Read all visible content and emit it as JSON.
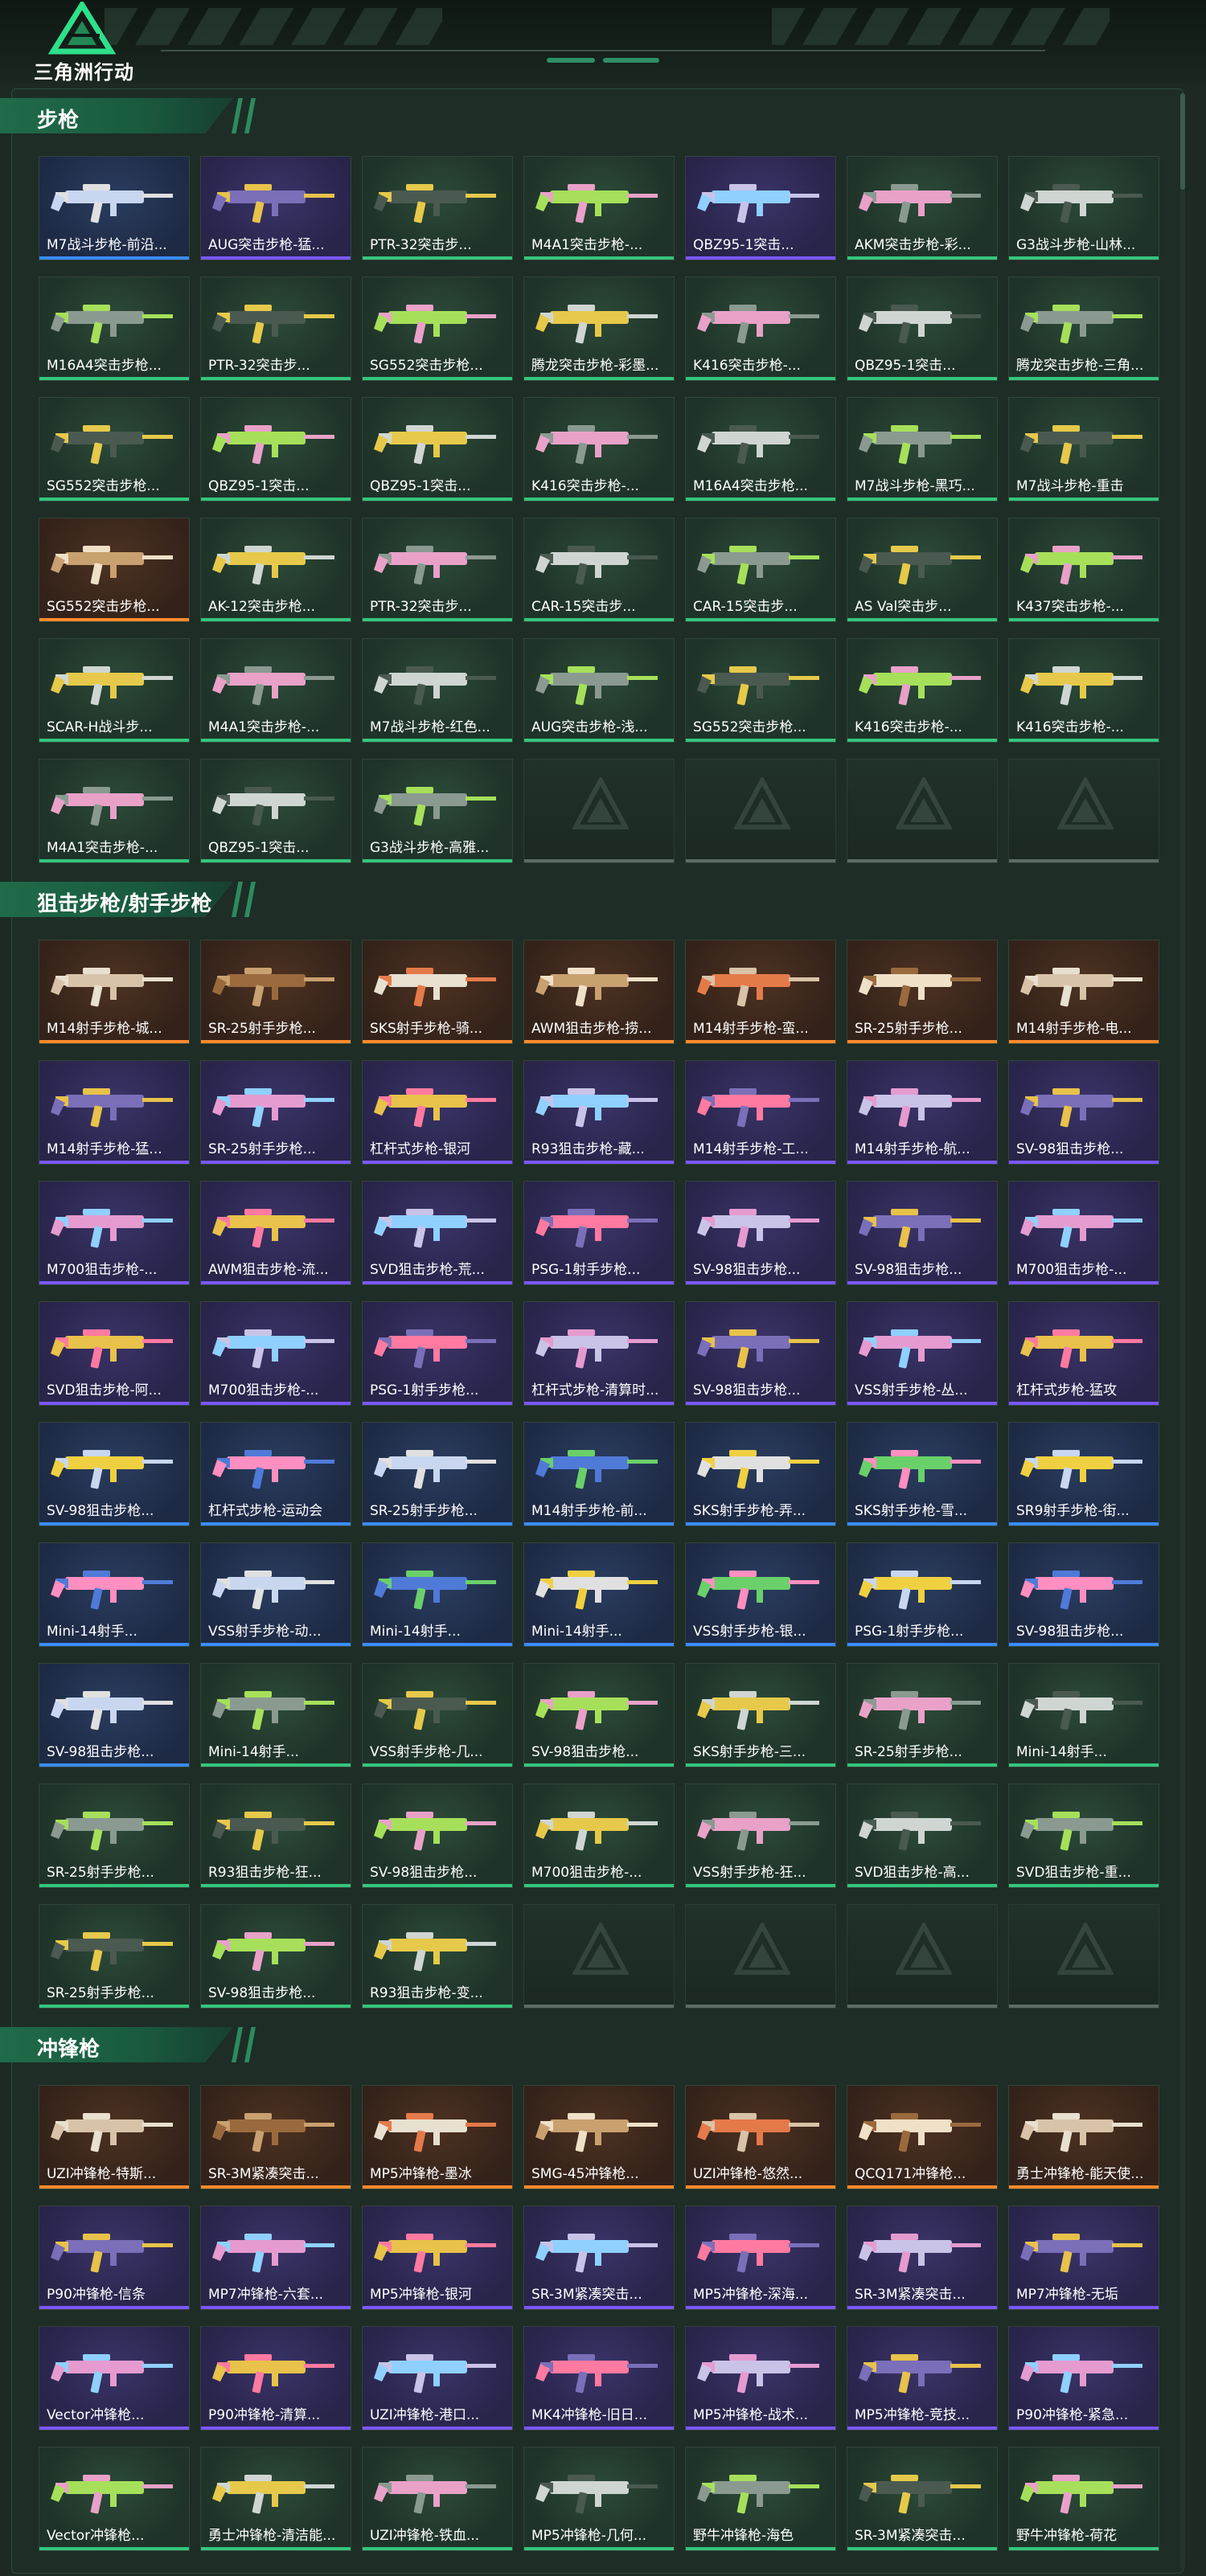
{
  "app": {
    "logo_text": "三角洲行动"
  },
  "colors": {
    "green": "#34c57d",
    "purple": "#7b57ff",
    "orange": "#ff8a2a",
    "blue": "#3a8cff"
  },
  "sections": [
    {
      "title": "步枪",
      "items": [
        {
          "name": "M7战斗步枪-前沿...",
          "rarity": "blue"
        },
        {
          "name": "AUG突击步枪-猛...",
          "rarity": "purple"
        },
        {
          "name": "PTR-32突击步...",
          "rarity": "green"
        },
        {
          "name": "M4A1突击步枪-...",
          "rarity": "green"
        },
        {
          "name": "QBZ95-1突击...",
          "rarity": "purple"
        },
        {
          "name": "AKM突击步枪-彩...",
          "rarity": "green"
        },
        {
          "name": "G3战斗步枪-山林...",
          "rarity": "green"
        },
        {
          "name": "M16A4突击步枪...",
          "rarity": "green"
        },
        {
          "name": "PTR-32突击步...",
          "rarity": "green"
        },
        {
          "name": "SG552突击步枪...",
          "rarity": "green"
        },
        {
          "name": "腾龙突击步枪-彩墨...",
          "rarity": "green"
        },
        {
          "name": "K416突击步枪-...",
          "rarity": "green"
        },
        {
          "name": "QBZ95-1突击...",
          "rarity": "green"
        },
        {
          "name": "腾龙突击步枪-三角...",
          "rarity": "green"
        },
        {
          "name": "SG552突击步枪...",
          "rarity": "green"
        },
        {
          "name": "QBZ95-1突击...",
          "rarity": "green"
        },
        {
          "name": "QBZ95-1突击...",
          "rarity": "green"
        },
        {
          "name": "K416突击步枪-...",
          "rarity": "green"
        },
        {
          "name": "M16A4突击步枪...",
          "rarity": "green"
        },
        {
          "name": "M7战斗步枪-黑巧...",
          "rarity": "green"
        },
        {
          "name": "M7战斗步枪-重击",
          "rarity": "green"
        },
        {
          "name": "SG552突击步枪...",
          "rarity": "orange"
        },
        {
          "name": "AK-12突击步枪...",
          "rarity": "green"
        },
        {
          "name": "PTR-32突击步...",
          "rarity": "green"
        },
        {
          "name": "CAR-15突击步...",
          "rarity": "green"
        },
        {
          "name": "CAR-15突击步...",
          "rarity": "green"
        },
        {
          "name": "AS Val突击步...",
          "rarity": "green"
        },
        {
          "name": "K437突击步枪-...",
          "rarity": "green"
        },
        {
          "name": "SCAR-H战斗步...",
          "rarity": "green"
        },
        {
          "name": "M4A1突击步枪-...",
          "rarity": "green"
        },
        {
          "name": "M7战斗步枪-红色...",
          "rarity": "green"
        },
        {
          "name": "AUG突击步枪-浅...",
          "rarity": "green"
        },
        {
          "name": "SG552突击步枪...",
          "rarity": "green"
        },
        {
          "name": "K416突击步枪-...",
          "rarity": "green"
        },
        {
          "name": "K416突击步枪-...",
          "rarity": "green"
        },
        {
          "name": "M4A1突击步枪-...",
          "rarity": "green"
        },
        {
          "name": "QBZ95-1突击...",
          "rarity": "green"
        },
        {
          "name": "G3战斗步枪-高雅...",
          "rarity": "green"
        },
        {
          "name": "",
          "rarity": "empty"
        },
        {
          "name": "",
          "rarity": "empty"
        },
        {
          "name": "",
          "rarity": "empty"
        },
        {
          "name": "",
          "rarity": "empty"
        }
      ]
    },
    {
      "title": "狙击步枪/射手步枪",
      "items": [
        {
          "name": "M14射手步枪-城...",
          "rarity": "orange"
        },
        {
          "name": "SR-25射手步枪...",
          "rarity": "orange"
        },
        {
          "name": "SKS射手步枪-骑...",
          "rarity": "orange"
        },
        {
          "name": "AWM狙击步枪-捞...",
          "rarity": "orange"
        },
        {
          "name": "M14射手步枪-蛮...",
          "rarity": "orange"
        },
        {
          "name": "SR-25射手步枪...",
          "rarity": "orange"
        },
        {
          "name": "M14射手步枪-电...",
          "rarity": "orange"
        },
        {
          "name": "M14射手步枪-猛...",
          "rarity": "purple"
        },
        {
          "name": "SR-25射手步枪...",
          "rarity": "purple"
        },
        {
          "name": "杠杆式步枪-银河",
          "rarity": "purple"
        },
        {
          "name": "R93狙击步枪-藏...",
          "rarity": "purple"
        },
        {
          "name": "M14射手步枪-工...",
          "rarity": "purple"
        },
        {
          "name": "M14射手步枪-航...",
          "rarity": "purple"
        },
        {
          "name": "SV-98狙击步枪...",
          "rarity": "purple"
        },
        {
          "name": "M700狙击步枪-...",
          "rarity": "purple"
        },
        {
          "name": "AWM狙击步枪-流...",
          "rarity": "purple"
        },
        {
          "name": "SVD狙击步枪-荒...",
          "rarity": "purple"
        },
        {
          "name": "PSG-1射手步枪...",
          "rarity": "purple"
        },
        {
          "name": "SV-98狙击步枪...",
          "rarity": "purple"
        },
        {
          "name": "SV-98狙击步枪...",
          "rarity": "purple"
        },
        {
          "name": "M700狙击步枪-...",
          "rarity": "purple"
        },
        {
          "name": "SVD狙击步枪-阿...",
          "rarity": "purple"
        },
        {
          "name": "M700狙击步枪-...",
          "rarity": "purple"
        },
        {
          "name": "PSG-1射手步枪...",
          "rarity": "purple"
        },
        {
          "name": "杠杆式步枪-清算时...",
          "rarity": "purple"
        },
        {
          "name": "SV-98狙击步枪...",
          "rarity": "purple"
        },
        {
          "name": "VSS射手步枪-丛...",
          "rarity": "purple"
        },
        {
          "name": "杠杆式步枪-猛攻",
          "rarity": "purple"
        },
        {
          "name": "SV-98狙击步枪...",
          "rarity": "blue"
        },
        {
          "name": "杠杆式步枪-运动会",
          "rarity": "blue"
        },
        {
          "name": "SR-25射手步枪...",
          "rarity": "blue"
        },
        {
          "name": "M14射手步枪-前...",
          "rarity": "blue"
        },
        {
          "name": "SKS射手步枪-弄...",
          "rarity": "blue"
        },
        {
          "name": "SKS射手步枪-雪...",
          "rarity": "blue"
        },
        {
          "name": "SR9射手步枪-街...",
          "rarity": "blue"
        },
        {
          "name": "Mini-14射手...",
          "rarity": "blue"
        },
        {
          "name": "VSS射手步枪-动...",
          "rarity": "blue"
        },
        {
          "name": "Mini-14射手...",
          "rarity": "blue"
        },
        {
          "name": "Mini-14射手...",
          "rarity": "blue"
        },
        {
          "name": "VSS射手步枪-银...",
          "rarity": "blue"
        },
        {
          "name": "PSG-1射手步枪...",
          "rarity": "blue"
        },
        {
          "name": "SV-98狙击步枪...",
          "rarity": "blue"
        },
        {
          "name": "SV-98狙击步枪...",
          "rarity": "blue"
        },
        {
          "name": "Mini-14射手...",
          "rarity": "green"
        },
        {
          "name": "VSS射手步枪-几...",
          "rarity": "green"
        },
        {
          "name": "SV-98狙击步枪...",
          "rarity": "green"
        },
        {
          "name": "SKS射手步枪-三...",
          "rarity": "green"
        },
        {
          "name": "SR-25射手步枪...",
          "rarity": "green"
        },
        {
          "name": "Mini-14射手...",
          "rarity": "green"
        },
        {
          "name": "SR-25射手步枪...",
          "rarity": "green"
        },
        {
          "name": "R93狙击步枪-狂...",
          "rarity": "green"
        },
        {
          "name": "SV-98狙击步枪...",
          "rarity": "green"
        },
        {
          "name": "M700狙击步枪-...",
          "rarity": "green"
        },
        {
          "name": "VSS射手步枪-狂...",
          "rarity": "green"
        },
        {
          "name": "SVD狙击步枪-高...",
          "rarity": "green"
        },
        {
          "name": "SVD狙击步枪-重...",
          "rarity": "green"
        },
        {
          "name": "SR-25射手步枪...",
          "rarity": "green"
        },
        {
          "name": "SV-98狙击步枪...",
          "rarity": "green"
        },
        {
          "name": "R93狙击步枪-变...",
          "rarity": "green"
        },
        {
          "name": "",
          "rarity": "empty"
        },
        {
          "name": "",
          "rarity": "empty"
        },
        {
          "name": "",
          "rarity": "empty"
        },
        {
          "name": "",
          "rarity": "empty"
        }
      ]
    },
    {
      "title": "冲锋枪",
      "items": [
        {
          "name": "UZI冲锋枪-特斯...",
          "rarity": "orange"
        },
        {
          "name": "SR-3M紧凑突击...",
          "rarity": "orange"
        },
        {
          "name": "MP5冲锋枪-墨冰",
          "rarity": "orange"
        },
        {
          "name": "SMG-45冲锋枪...",
          "rarity": "orange"
        },
        {
          "name": "UZI冲锋枪-悠然...",
          "rarity": "orange"
        },
        {
          "name": "QCQ171冲锋枪...",
          "rarity": "orange"
        },
        {
          "name": "勇士冲锋枪-能天使...",
          "rarity": "orange"
        },
        {
          "name": "P90冲锋枪-信条",
          "rarity": "purple"
        },
        {
          "name": "MP7冲锋枪-六套...",
          "rarity": "purple"
        },
        {
          "name": "MP5冲锋枪-银河",
          "rarity": "purple"
        },
        {
          "name": "SR-3M紧凑突击...",
          "rarity": "purple"
        },
        {
          "name": "MP5冲锋枪-深海...",
          "rarity": "purple"
        },
        {
          "name": "SR-3M紧凑突击...",
          "rarity": "purple"
        },
        {
          "name": "MP7冲锋枪-无垢",
          "rarity": "purple"
        },
        {
          "name": "Vector冲锋枪...",
          "rarity": "purple"
        },
        {
          "name": "P90冲锋枪-清算...",
          "rarity": "purple"
        },
        {
          "name": "UZI冲锋枪-港口...",
          "rarity": "purple"
        },
        {
          "name": "MK4冲锋枪-旧日...",
          "rarity": "purple"
        },
        {
          "name": "MP5冲锋枪-战术...",
          "rarity": "purple"
        },
        {
          "name": "MP5冲锋枪-竞技...",
          "rarity": "purple"
        },
        {
          "name": "P90冲锋枪-紧急...",
          "rarity": "purple"
        },
        {
          "name": "Vector冲锋枪...",
          "rarity": "green"
        },
        {
          "name": "勇士冲锋枪-清洁能...",
          "rarity": "green"
        },
        {
          "name": "UZI冲锋枪-铁血...",
          "rarity": "green"
        },
        {
          "name": "MP5冲锋枪-几何...",
          "rarity": "green"
        },
        {
          "name": "野牛冲锋枪-海色",
          "rarity": "green"
        },
        {
          "name": "SR-3M紧凑突击...",
          "rarity": "green"
        },
        {
          "name": "野牛冲锋枪-荷花",
          "rarity": "green"
        }
      ]
    }
  ]
}
